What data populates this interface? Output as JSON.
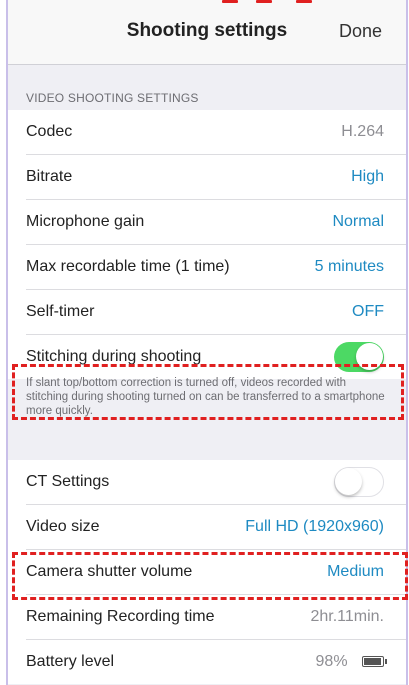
{
  "header": {
    "title": "Shooting settings",
    "done_label": "Done"
  },
  "video_section": {
    "header": "VIDEO SHOOTING SETTINGS",
    "rows": [
      {
        "label": "Codec",
        "value": "H.264"
      },
      {
        "label": "Bitrate",
        "value": "High"
      },
      {
        "label": "Microphone gain",
        "value": "Normal"
      },
      {
        "label": "Max recordable time (1 time)",
        "value": "5 minutes"
      },
      {
        "label": "Self-timer",
        "value": "OFF"
      }
    ],
    "stitching": {
      "label": "Stitching during shooting",
      "enabled": true
    },
    "note": "If slant top/bottom correction is turned off, videos recorded with stitching during shooting turned on can be transferred to a smartphone more quickly."
  },
  "other_section": {
    "ct_settings": {
      "label": "CT Settings",
      "enabled": false
    },
    "rows": [
      {
        "label": "Video size",
        "value": "Full HD (1920x960)"
      },
      {
        "label": "Camera shutter volume",
        "value": "Medium"
      },
      {
        "label": "Remaining Recording time",
        "value": "2hr.11min."
      },
      {
        "label": "Battery level",
        "value": "98%"
      }
    ]
  },
  "colors": {
    "accent": "#1e8ac2",
    "toggle_on": "#4cd964",
    "annotation": "#e02020",
    "background": "#efeff4"
  },
  "icons": {
    "battery": "battery-icon"
  }
}
